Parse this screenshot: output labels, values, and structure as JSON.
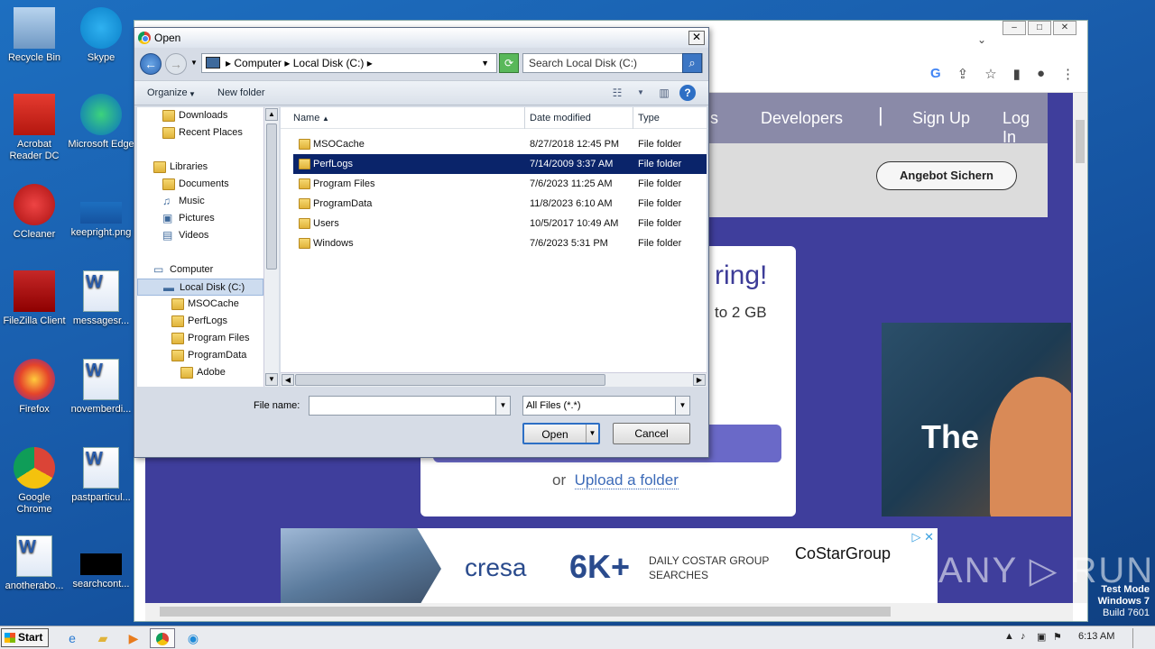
{
  "desktop": {
    "icons": [
      {
        "label": "Recycle Bin",
        "icon": "recycle-bin-icon"
      },
      {
        "label": "Skype",
        "icon": "skype-icon"
      },
      {
        "label": "Acrobat Reader DC",
        "icon": "acrobat-icon"
      },
      {
        "label": "Microsoft Edge",
        "icon": "edge-icon"
      },
      {
        "label": "CCleaner",
        "icon": "ccleaner-icon"
      },
      {
        "label": "keepright.png",
        "icon": "image-file-icon"
      },
      {
        "label": "FileZilla Client",
        "icon": "filezilla-icon"
      },
      {
        "label": "messagesr...",
        "icon": "word-doc-icon"
      },
      {
        "label": "Firefox",
        "icon": "firefox-icon"
      },
      {
        "label": "novemberdi...",
        "icon": "word-doc-icon"
      },
      {
        "label": "Google Chrome",
        "icon": "chrome-icon"
      },
      {
        "label": "pastparticul...",
        "icon": "word-doc-icon"
      },
      {
        "label": "anotherabo...",
        "icon": "word-doc-icon"
      },
      {
        "label": "searchcont...",
        "icon": "black-file-icon"
      }
    ]
  },
  "browser": {
    "nav": {
      "item1": "ns",
      "item2": "Developers",
      "item3": "Sign Up",
      "item4": "Log In"
    },
    "angebot_button": "Angebot Sichern",
    "card": {
      "headline": "ring!",
      "sub": "to 2 GB",
      "or": "or",
      "upload_link": "Upload a folder"
    },
    "photo_text": "The",
    "ad": {
      "brand": "cresa",
      "big": "6K+",
      "daily": "DAILY COSTAR GROUP SEARCHES",
      "costar": "CoStarGroup"
    }
  },
  "dialog": {
    "title": "Open",
    "close": "✕",
    "breadcrumb": {
      "part1": "Computer",
      "part2": "Local Disk (C:)"
    },
    "search_placeholder": "Search Local Disk (C:)",
    "toolbar": {
      "organize": "Organize",
      "new_folder": "New folder"
    },
    "nav_tree": [
      {
        "label": "Downloads",
        "indent": 1,
        "type": "folder"
      },
      {
        "label": "Recent Places",
        "indent": 1,
        "type": "recent"
      },
      {
        "label": "",
        "indent": 0,
        "type": "spacer"
      },
      {
        "label": "Libraries",
        "indent": 0,
        "type": "library"
      },
      {
        "label": "Documents",
        "indent": 1,
        "type": "doc"
      },
      {
        "label": "Music",
        "indent": 1,
        "type": "music"
      },
      {
        "label": "Pictures",
        "indent": 1,
        "type": "pic"
      },
      {
        "label": "Videos",
        "indent": 1,
        "type": "video"
      },
      {
        "label": "",
        "indent": 0,
        "type": "spacer"
      },
      {
        "label": "Computer",
        "indent": 0,
        "type": "computer"
      },
      {
        "label": "Local Disk (C:)",
        "indent": 1,
        "type": "disk",
        "selected": true
      },
      {
        "label": "MSOCache",
        "indent": 2,
        "type": "folder"
      },
      {
        "label": "PerfLogs",
        "indent": 2,
        "type": "folder"
      },
      {
        "label": "Program Files",
        "indent": 2,
        "type": "folder"
      },
      {
        "label": "ProgramData",
        "indent": 2,
        "type": "folder"
      },
      {
        "label": "Adobe",
        "indent": 3,
        "type": "folder"
      }
    ],
    "columns": {
      "name": "Name",
      "date": "Date modified",
      "type": "Type"
    },
    "files": [
      {
        "name": "MSOCache",
        "date": "8/27/2018 12:45 PM",
        "type": "File folder",
        "locked": true
      },
      {
        "name": "PerfLogs",
        "date": "7/14/2009 3:37 AM",
        "type": "File folder",
        "selected": true
      },
      {
        "name": "Program Files",
        "date": "7/6/2023 11:25 AM",
        "type": "File folder"
      },
      {
        "name": "ProgramData",
        "date": "11/8/2023 6:10 AM",
        "type": "File folder"
      },
      {
        "name": "Users",
        "date": "10/5/2017 10:49 AM",
        "type": "File folder"
      },
      {
        "name": "Windows",
        "date": "7/6/2023 5:31 PM",
        "type": "File folder"
      }
    ],
    "file_name_label": "File name:",
    "file_name_value": "",
    "file_type": "All Files (*.*)",
    "open_button": "Open",
    "cancel_button": "Cancel"
  },
  "taskbar": {
    "start": "Start",
    "time": "6:13 AM"
  },
  "watermark": {
    "line1": "Test Mode",
    "line2": "Windows 7",
    "line3": "Build 7601",
    "anyrun": "ANY ▷ RUN"
  }
}
